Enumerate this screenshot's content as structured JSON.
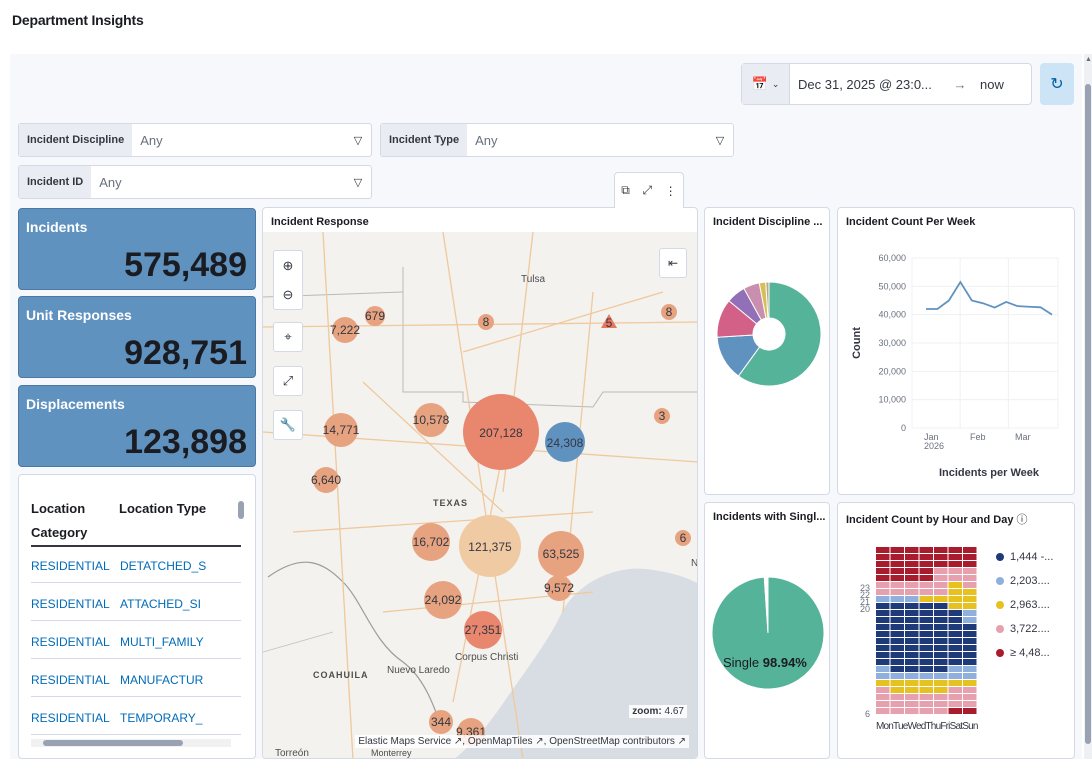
{
  "page": {
    "title": "Department Insights"
  },
  "timepicker": {
    "start": "Dec 31, 2025 @ 23:0...",
    "arrow": "→",
    "end": "now"
  },
  "filters": [
    {
      "label": "Incident Discipline",
      "value": "Any"
    },
    {
      "label": "Incident Type",
      "value": "Any"
    },
    {
      "label": "Incident ID",
      "value": "Any"
    }
  ],
  "metrics": [
    {
      "label": "Incidents",
      "value": "575,489"
    },
    {
      "label": "Unit Responses",
      "value": "928,751"
    },
    {
      "label": "Displacements",
      "value": "123,898"
    }
  ],
  "table": {
    "headers": [
      "Location Category",
      "Location Type"
    ],
    "rows": [
      [
        "RESIDENTIAL",
        "DETATCHED_S"
      ],
      [
        "RESIDENTIAL",
        "ATTACHED_SI"
      ],
      [
        "RESIDENTIAL",
        "MULTI_FAMILY"
      ],
      [
        "RESIDENTIAL",
        "MANUFACTUR"
      ],
      [
        "RESIDENTIAL",
        "TEMPORARY_"
      ]
    ]
  },
  "map": {
    "title": "Incident Response",
    "zoom_label": "zoom:",
    "zoom_value": "4.67",
    "attribution": "Elastic Maps Service ↗, OpenMapTiles ↗, OpenStreetMap contributors ↗",
    "places": [
      "Tulsa",
      "TEXAS",
      "COAHUILA",
      "Nuevo Laredo",
      "Corpus Christi",
      "Torreón",
      "Monterrey",
      "N"
    ],
    "clusters": [
      "7,222",
      "679",
      "8",
      "5",
      "8",
      "10,578",
      "14,771",
      "207,128",
      "24,308",
      "3",
      "6,640",
      "16,702",
      "121,375",
      "63,525",
      "6",
      "24,092",
      "9,572",
      "27,351",
      "344",
      "9,361"
    ]
  },
  "discipline_panel": {
    "title": "Incident Discipline ..."
  },
  "single_panel": {
    "title": "Incidents with Singl...",
    "label": "Single",
    "pct": "98.94%"
  },
  "weekly_panel": {
    "title": "Incident Count Per Week",
    "ylabel": "Count",
    "xlabel": "Incidents per Week",
    "y_ticks": [
      "60,000",
      "50,000",
      "40,000",
      "30,000",
      "20,000",
      "10,000",
      "0"
    ],
    "x_ticks": [
      "Jan",
      "2026",
      "Feb",
      "Mar"
    ]
  },
  "heatmap_panel": {
    "title": "Incident Count by Hour and Day",
    "info_icon": "info-icon",
    "days": [
      "Mon",
      "Tue",
      "Wed",
      "Thu",
      "Fri",
      "Sat",
      "Sun"
    ],
    "y_labels": [
      "23",
      "22",
      "21",
      "20",
      "6"
    ],
    "legend": [
      {
        "label": "1,444 -...",
        "color": "#1f3a78"
      },
      {
        "label": "2,203....",
        "color": "#8fb0dc"
      },
      {
        "label": "2,963....",
        "color": "#e6c220"
      },
      {
        "label": "3,722....",
        "color": "#e6a0ae"
      },
      {
        "label": "≥ 4,48...",
        "color": "#a81c2e"
      }
    ]
  },
  "chart_data": [
    {
      "type": "line",
      "title": "Incident Count Per Week",
      "xlabel": "Incidents per Week",
      "ylabel": "Count",
      "ylim": [
        0,
        60000
      ],
      "series": [
        {
          "values": [
            42000,
            42000,
            45000,
            51500,
            45000,
            44000,
            42500,
            44500,
            43000,
            42800,
            42600,
            40000
          ]
        }
      ]
    },
    {
      "type": "pie",
      "title": "Incident Discipline ...",
      "values": [
        60,
        14,
        12,
        6,
        5,
        2,
        1
      ],
      "colors": [
        "#54b399",
        "#6092c0",
        "#d36086",
        "#9170b8",
        "#ca8eae",
        "#d6bf57",
        "#b9a888"
      ]
    },
    {
      "type": "pie",
      "title": "Incidents with Singl...",
      "values": [
        98.94,
        1.06
      ],
      "labels": [
        "Single",
        ""
      ],
      "colors": [
        "#54b399",
        "#ffffff"
      ]
    }
  ]
}
